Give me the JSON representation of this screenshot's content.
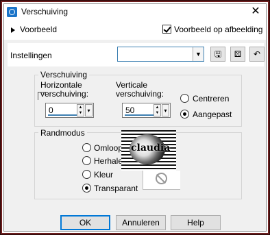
{
  "window": {
    "title": "Verschuiving"
  },
  "preview": {
    "expander_label": "Voorbeeld",
    "on_image_label": "Voorbeeld op afbeelding",
    "on_image_checked": true
  },
  "settings": {
    "label": "Instellingen",
    "preset_value": ""
  },
  "offset_group": {
    "title": "Verschuiving",
    "horizontal_label_1": "Horizontale",
    "horizontal_label_2": "verschuiving:",
    "horizontal_value": "0",
    "vertical_label_1": "Verticale",
    "vertical_label_2": "verschuiving:",
    "vertical_value": "50",
    "radio_center": "Centreren",
    "radio_custom": "Aangepast",
    "selected": "Aangepast"
  },
  "edge_group": {
    "title": "Randmodus",
    "options": [
      "Omloop",
      "Herhalen",
      "Kleur",
      "Transparant"
    ],
    "selected": "Transparant",
    "preview_text": "claudia"
  },
  "buttons": {
    "ok": "OK",
    "cancel": "Annuleren",
    "help": "Help"
  },
  "colors": {
    "frame": "#6b1d1d",
    "accent": "#0078d7",
    "dialog_bg": "#f0f0f0"
  }
}
